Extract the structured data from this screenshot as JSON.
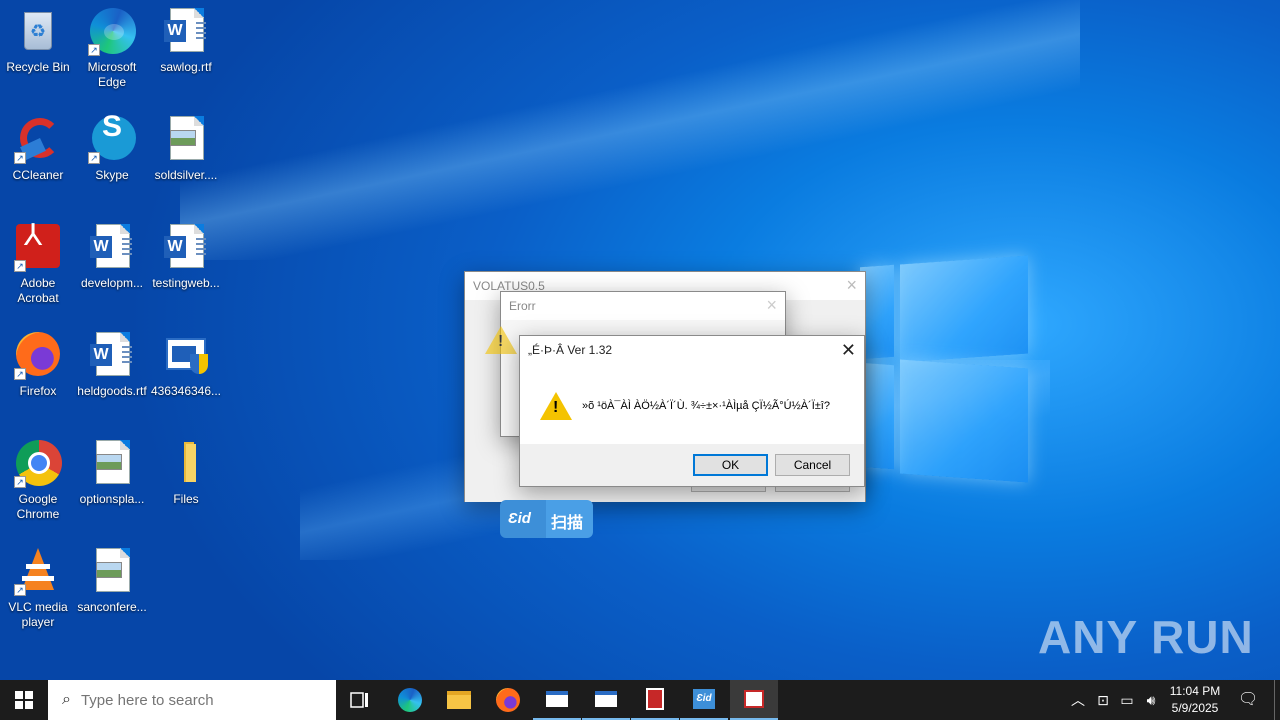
{
  "desktop": {
    "icons": [
      {
        "label": "Recycle Bin",
        "icon": "recycle-bin-icon"
      },
      {
        "label": "Microsoft Edge",
        "icon": "edge-icon"
      },
      {
        "label": "sawlog.rtf",
        "icon": "word-document-icon"
      },
      {
        "label": "CCleaner",
        "icon": "ccleaner-icon"
      },
      {
        "label": "Skype",
        "icon": "skype-icon"
      },
      {
        "label": "soldsilver....",
        "icon": "image-file-icon"
      },
      {
        "label": "Adobe Acrobat",
        "icon": "acrobat-icon"
      },
      {
        "label": "developm...",
        "icon": "word-document-icon"
      },
      {
        "label": "testingweb...",
        "icon": "word-document-icon"
      },
      {
        "label": "Firefox",
        "icon": "firefox-icon"
      },
      {
        "label": "heldgoods.rtf",
        "icon": "word-document-icon"
      },
      {
        "label": "436346346...",
        "icon": "installer-icon"
      },
      {
        "label": "Google Chrome",
        "icon": "chrome-icon"
      },
      {
        "label": "optionspla...",
        "icon": "image-file-icon"
      },
      {
        "label": "Files",
        "icon": "folder-icon"
      },
      {
        "label": "VLC media player",
        "icon": "vlc-icon"
      },
      {
        "label": "sanconfere...",
        "icon": "image-file-icon"
      }
    ]
  },
  "dialogs": {
    "volatus": {
      "title": "VOLATUS0.5"
    },
    "error": {
      "title": "Erorr"
    },
    "main": {
      "title": "„É·Þ·Â Ver 1.32",
      "message": "»õ ¹öÀ¯ÀÌ ÀÖ½À´Ï´Ù. ¾÷±×·¹ÀÌµå ÇÏ½Ã°Ú½À´Ï±î?",
      "ok_label": "OK",
      "cancel_label": "Cancel"
    }
  },
  "scan_badge": {
    "logo": "Ɛid",
    "label": "扫描"
  },
  "taskbar": {
    "search_placeholder": "Type here to search",
    "clock_time": "11:04 PM",
    "clock_date": "5/9/2025"
  },
  "watermark": "ANY RUN",
  "colors": {
    "accent": "#0078d7",
    "taskbar": "#1c1c1c",
    "warning": "#f4c300"
  }
}
